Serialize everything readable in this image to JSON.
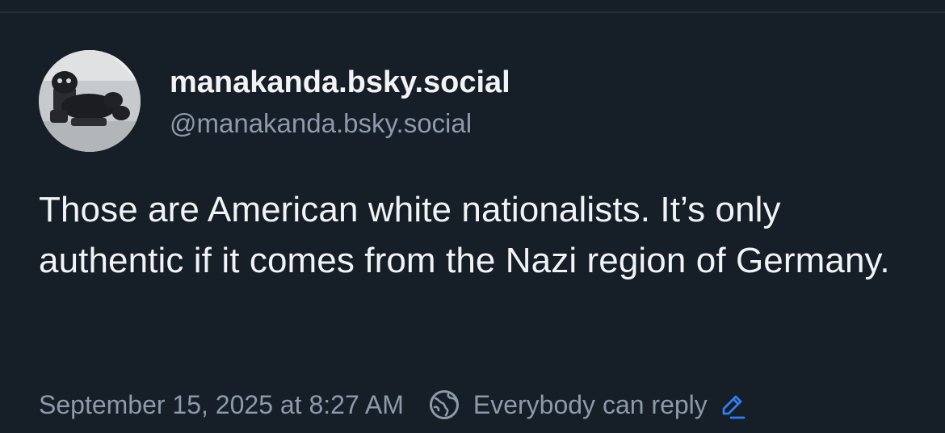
{
  "post": {
    "author": {
      "display_name": "manakanda.bsky.social",
      "handle": "@manakanda.bsky.social"
    },
    "text": "Those are American white nationalists. It’s only authentic if it comes from the Nazi region of Germany.",
    "timestamp": "September 15, 2025 at 8:27 AM",
    "reply_setting": "Everybody can reply"
  },
  "icons": {
    "avatar": "avatar",
    "reply_setting": "globe-icon",
    "edit": "pencil-icon"
  },
  "colors": {
    "background": "#161e27",
    "primary_text": "#f1f3f5",
    "secondary_text": "#8d9aab",
    "accent": "#2f7ff0"
  }
}
